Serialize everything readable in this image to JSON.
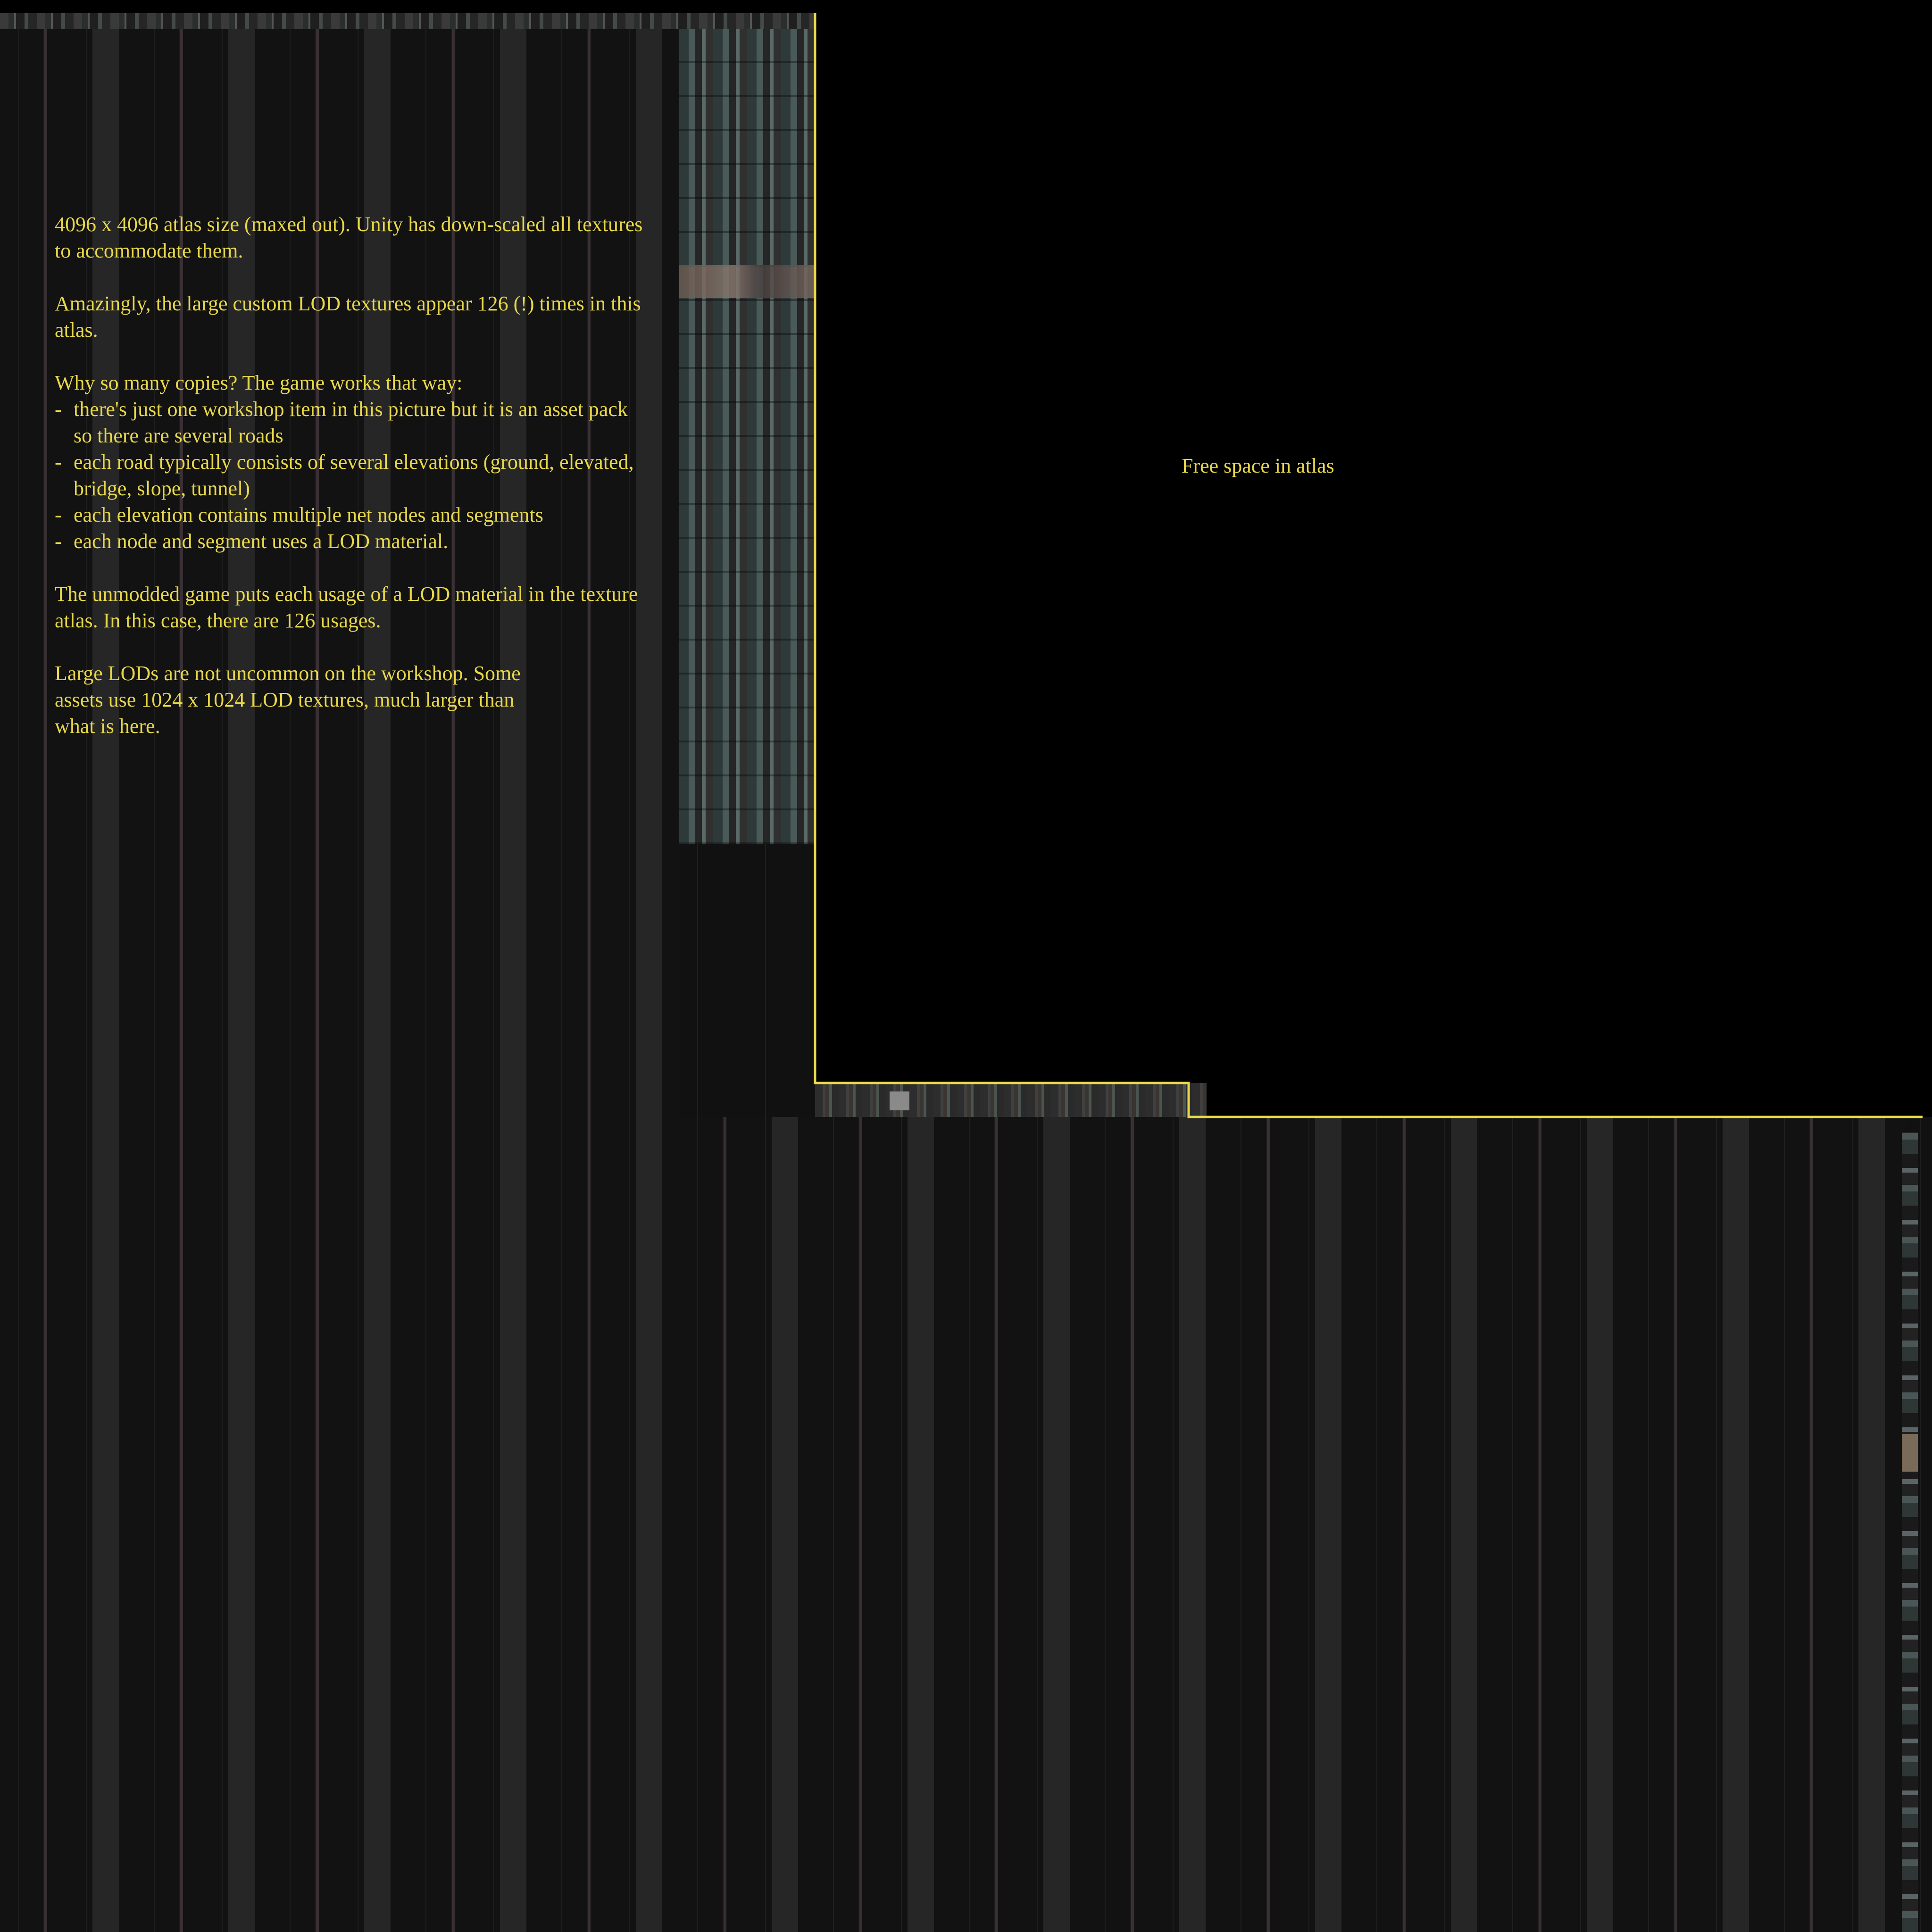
{
  "annotation": {
    "intro": "4096 x 4096 atlas size (maxed out). Unity has down-scaled all textures to accommodate them.",
    "copies": "Amazingly, the large custom LOD textures appear 126 (!) times in this atlas.",
    "why_heading": "Why so many copies? The game works that way:",
    "reasons": [
      "there's just one workshop item in this picture but it is an asset pack so there are several roads",
      "each road typically consists of several elevations (ground, elevated, bridge, slope, tunnel)",
      "each elevation contains multiple net nodes and segments",
      "each node and segment uses a LOD material."
    ],
    "reason_bullet": "-",
    "unmodded": "The unmodded game puts each usage of a LOD material in the texture atlas. In this case, there are 126 usages.",
    "large_lods": "Large LODs are  not uncommon on the workshop. Some assets use 1024 x 1024 LOD textures, much larger than what is here."
  },
  "free_space_label": "Free space in atlas",
  "colors": {
    "annotation_text": "#e8d84a",
    "outline": "#e8d84a",
    "free_space": "#000000",
    "atlas_background": "#111111"
  }
}
